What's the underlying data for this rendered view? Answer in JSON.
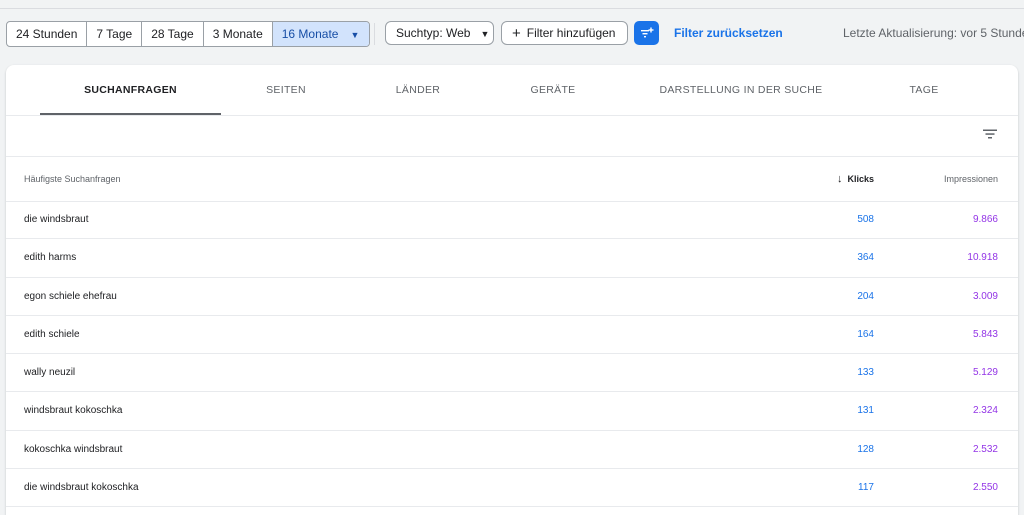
{
  "toolbar": {
    "date_ranges": [
      "24 Stunden",
      "7 Tage",
      "28 Tage",
      "3 Monate",
      "16 Monate"
    ],
    "selected_range_index": 4,
    "search_type_label": "Suchtyp: Web",
    "add_filter_label": "Filter hinzufügen",
    "reset_filter_label": "Filter zurücksetzen",
    "last_update_label": "Letzte Aktualisierung: vor 5 Stunden"
  },
  "tabs": [
    "SUCHANFRAGEN",
    "SEITEN",
    "LÄNDER",
    "GERÄTE",
    "DARSTELLUNG IN DER SUCHE",
    "TAGE"
  ],
  "active_tab_index": 0,
  "table": {
    "headers": {
      "query": "Häufigste Suchanfragen",
      "clicks": "Klicks",
      "impressions": "Impressionen"
    },
    "sort_column": "clicks",
    "sort_direction": "descending",
    "rows": [
      {
        "query": "die windsbraut",
        "clicks": "508",
        "impressions": "9.866"
      },
      {
        "query": "edith harms",
        "clicks": "364",
        "impressions": "10.918"
      },
      {
        "query": "egon schiele ehefrau",
        "clicks": "204",
        "impressions": "3.009"
      },
      {
        "query": "edith schiele",
        "clicks": "164",
        "impressions": "5.843"
      },
      {
        "query": "wally neuzil",
        "clicks": "133",
        "impressions": "5.129"
      },
      {
        "query": "windsbraut kokoschka",
        "clicks": "131",
        "impressions": "2.324"
      },
      {
        "query": "kokoschka windsbraut",
        "clicks": "128",
        "impressions": "2.532"
      },
      {
        "query": "die windsbraut kokoschka",
        "clicks": "117",
        "impressions": "2.550"
      }
    ]
  },
  "colors": {
    "accent": "#1a73e8",
    "clicks": "#1a73e8",
    "impressions": "#9334e6",
    "selected_range_bg": "#d2e3fc"
  },
  "icons": {
    "dropdown": "caret-down-icon",
    "add": "plus-icon",
    "filter_button": "filter-add-icon",
    "table_filter": "filter-lines-icon",
    "sort": "arrow-down-icon"
  }
}
